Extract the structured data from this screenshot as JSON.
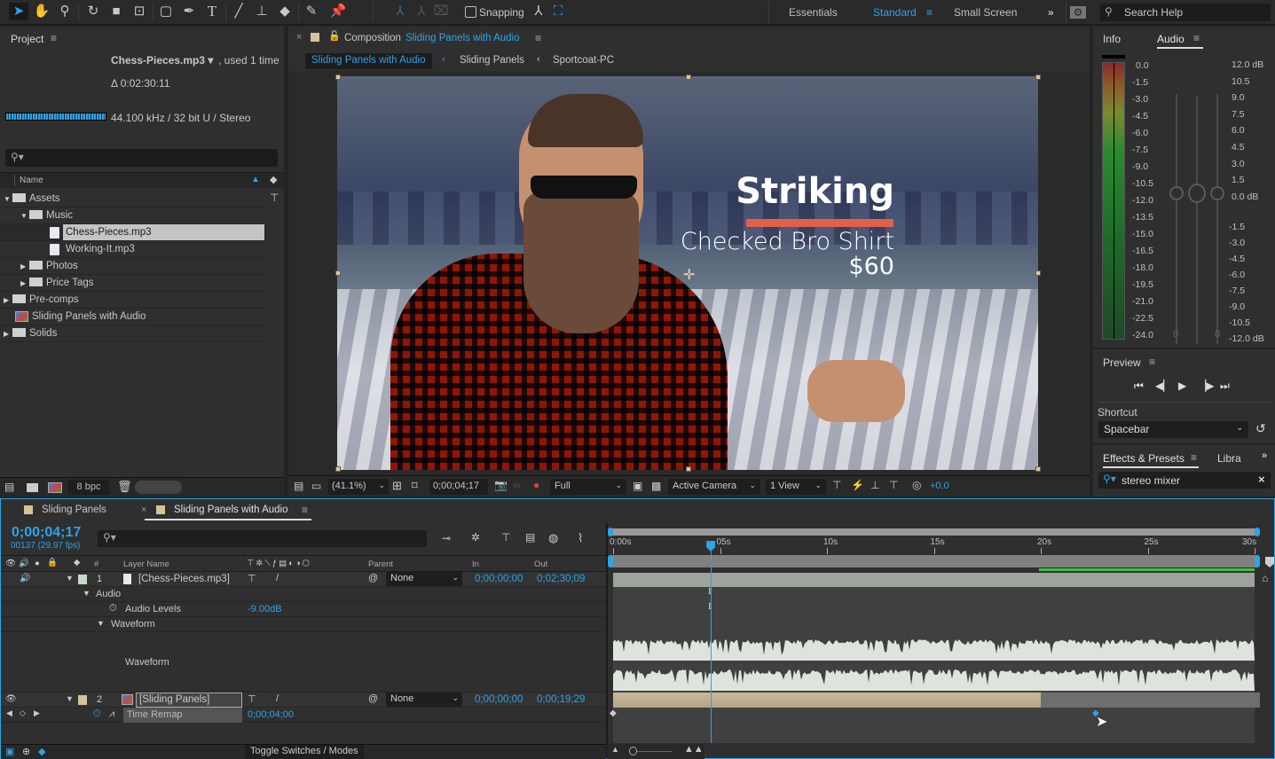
{
  "toolbar": {
    "tools": [
      "selection-tool",
      "hand-tool",
      "zoom-tool",
      "rotate-tool",
      "camera-tool",
      "pan-behind-tool",
      "rectangle-tool",
      "pen-tool",
      "type-tool",
      "brush-tool",
      "clone-stamp-tool",
      "eraser-tool",
      "roto-brush-tool",
      "puppet-pin-tool"
    ],
    "snapping_label": "Snapping",
    "snapping_checked": false,
    "workspaces": [
      "Essentials",
      "Standard",
      "Small Screen"
    ],
    "active_workspace": "Standard",
    "search_placeholder": "Search Help"
  },
  "project": {
    "title": "Project",
    "selected_file": "Chess-Pieces.mp3 ▾",
    "used_text": ", used 1 time",
    "duration": "Δ 0:02:30:11",
    "audio_info": "44.100 kHz / 32 bit U / Stereo",
    "search_placeholder": "",
    "column_name": "Name",
    "tree": [
      {
        "label": "Assets",
        "type": "folder",
        "expanded": true,
        "depth": 0
      },
      {
        "label": "Music",
        "type": "folder",
        "expanded": true,
        "depth": 1
      },
      {
        "label": "Chess-Pieces.mp3",
        "type": "audio",
        "depth": 2,
        "selected": true
      },
      {
        "label": "Working-It.mp3",
        "type": "audio",
        "depth": 2
      },
      {
        "label": "Photos",
        "type": "folder",
        "expanded": false,
        "depth": 1
      },
      {
        "label": "Price Tags",
        "type": "folder",
        "expanded": false,
        "depth": 1
      },
      {
        "label": "Pre-comps",
        "type": "folder",
        "expanded": false,
        "depth": 0
      },
      {
        "label": "Sliding Panels with Audio",
        "type": "composition",
        "depth": 0
      },
      {
        "label": "Solids",
        "type": "folder",
        "expanded": false,
        "depth": 0
      }
    ],
    "bpc": "8 bpc"
  },
  "composition": {
    "tab_prefix": "Composition",
    "tab_name": "Sliding Panels with Audio",
    "breadcrumbs": [
      "Sliding Panels with Audio",
      "Sliding Panels",
      "Sportcoat-PC"
    ],
    "overlay": {
      "headline": "Striking",
      "product": "Checked Bro Shirt",
      "price": "$60",
      "accent_color": "#e0604a"
    },
    "footer": {
      "zoom": "(41.1%)",
      "timecode": "0;00;04;17",
      "resolution": "Full",
      "camera": "Active Camera",
      "views": "1 View",
      "exposure": "+0.0"
    }
  },
  "audio_panel": {
    "tabs": [
      "Info",
      "Audio"
    ],
    "active_tab": "Audio",
    "left_scale": [
      "0.0",
      "-1.5",
      "-3.0",
      "-4.5",
      "-6.0",
      "-7.5",
      "-9.0",
      "-10.5",
      "-12.0",
      "-13.5",
      "-15.0",
      "-16.5",
      "-18.0",
      "-19.5",
      "-21.0",
      "-22.5",
      "-24.0"
    ],
    "right_scale": [
      "12.0 dB",
      "10.5",
      "9.0",
      "7.5",
      "6.0",
      "4.5",
      "3.0",
      "1.5",
      "0.0 dB",
      "-1.5",
      "-3.0",
      "-4.5",
      "-6.0",
      "-7.5",
      "-9.0",
      "-10.5",
      "-12.0 dB"
    ],
    "slider_left_value": "0",
    "slider_right_value": "0"
  },
  "preview": {
    "title": "Preview",
    "shortcut_label": "Shortcut",
    "shortcut_value": "Spacebar"
  },
  "effects": {
    "tabs": [
      "Effects & Presets",
      "Libra"
    ],
    "search_value": "stereo mixer"
  },
  "timeline": {
    "tabs": [
      "Sliding Panels",
      "Sliding Panels with Audio"
    ],
    "active_tab": "Sliding Panels with Audio",
    "current_time": "0;00;04;17",
    "frame_info": "00137 (29.97 fps)",
    "columns": {
      "num": "#",
      "layer_name": "Layer Name",
      "parent": "Parent",
      "in": "In",
      "out": "Out"
    },
    "ruler": [
      "0:00s",
      "05s",
      "10s",
      "15s",
      "20s",
      "25s",
      "30s"
    ],
    "ruler_max_seconds": 30,
    "playhead_seconds": 4.57,
    "layers": [
      {
        "num": "1",
        "name": "[Chess-Pieces.mp3]",
        "parent": "None",
        "in": "0;00;00;00",
        "out": "0;02;30;09",
        "label_color": "#c8d8c8"
      },
      {
        "num": "2",
        "name": "[Sliding Panels]",
        "parent": "None",
        "in": "0;00;00;00",
        "out": "0;00;19;29",
        "label_color": "#d4c29a",
        "bar_end_seconds": 20
      }
    ],
    "props": {
      "audio": "Audio",
      "audio_levels": "Audio Levels",
      "audio_levels_value": "-9.00dB",
      "waveform_group": "Waveform",
      "waveform": "Waveform",
      "time_remap": "Time Remap",
      "time_remap_value": "0;00;04;00"
    },
    "toggle_label": "Toggle Switches / Modes"
  }
}
